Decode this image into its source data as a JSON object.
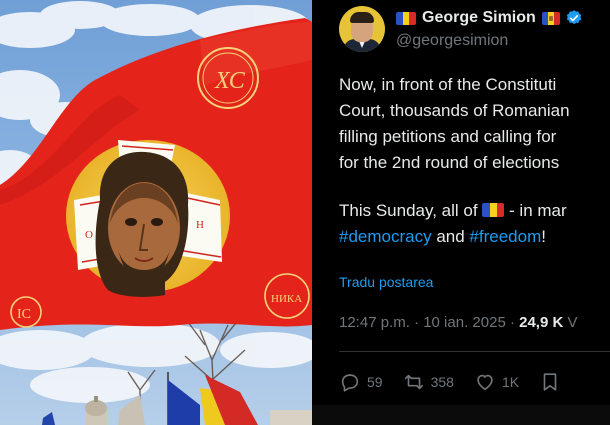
{
  "post": {
    "author": {
      "display_name": "George Simion",
      "handle": "@georgesimion",
      "verified": true
    },
    "text": {
      "line1": "Now, in front of the Constituti",
      "line2": "Court, thousands of Romanian",
      "line3": "filling petitions and calling for",
      "line4": "for the 2nd round of elections",
      "line5_before_flag": "This Sunday, all of ",
      "line5_after_flag": " - in mar",
      "hashtag1": "#democracy",
      "and": " and ",
      "hashtag2": "#freedom",
      "end": "!"
    },
    "translate_label": "Tradu postarea",
    "meta": {
      "time_date": "12:47 p.m. · 10 ian. 2025 · ",
      "views": "24,9 K",
      "views_suffix": " V"
    },
    "actions": {
      "replies": "59",
      "reposts": "358",
      "likes": "1K"
    }
  },
  "photo": {
    "flag_monogram_top": "ХС",
    "flag_monogram_left": "ІС",
    "flag_monogram_right": "НИКА"
  },
  "colors": {
    "banner_red": "#e4241b",
    "halo_yellow": "#f2c53a",
    "link_blue": "#1d9bf0",
    "text_primary": "#e7e9ea",
    "text_secondary": "#71767b"
  },
  "icons": [
    "flag-romania-icon",
    "flag-moldova-icon",
    "verified-badge-icon",
    "reply-icon",
    "repost-icon",
    "like-icon",
    "bookmark-icon"
  ]
}
